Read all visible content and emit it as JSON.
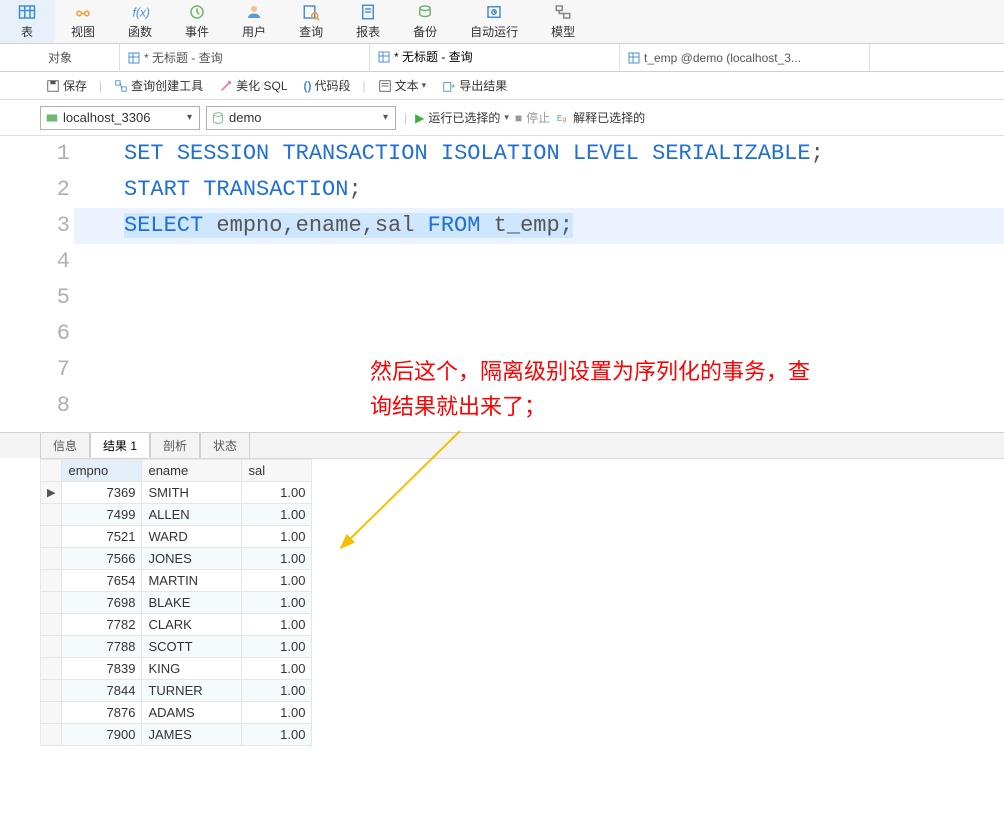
{
  "top_toolbar": {
    "table": "表",
    "view": "视图",
    "function": "函数",
    "event": "事件",
    "user": "用户",
    "query": "查询",
    "report": "报表",
    "backup": "备份",
    "autorun": "自动运行",
    "model": "模型"
  },
  "doc_tabs": {
    "object": "对象",
    "untitled1": "* 无标题 - 查询",
    "untitled2": "* 无标题 - 查询",
    "temp_tab": "t_emp @demo (localhost_3..."
  },
  "second_toolbar": {
    "save": "保存",
    "query_builder": "查询创建工具",
    "beautify": "美化 SQL",
    "snippet": "代码段",
    "text": "文本",
    "export": "导出结果"
  },
  "conn_bar": {
    "host": "localhost_3306",
    "db": "demo",
    "run_selected": "运行已选择的",
    "stop": "停止",
    "explain": "解释已选择的"
  },
  "sql": {
    "line1": {
      "a": "SET",
      "b": "SESSION",
      "c": "TRANSACTION",
      "d": "ISOLATION",
      "e": "LEVEL",
      "f": "SERIALIZABLE",
      "semi": ";"
    },
    "line2": {
      "a": "START",
      "b": "TRANSACTION",
      "semi": ";"
    },
    "line3": {
      "a": "SELECT",
      "cols": " empno,ename,sal ",
      "b": "FROM",
      "tbl": " t_emp",
      "semi": ";"
    }
  },
  "line_numbers": [
    "1",
    "2",
    "3",
    "4",
    "5",
    "6",
    "7",
    "8"
  ],
  "annotation": {
    "l1": "然后这个，隔离级别设置为序列化的事务，查",
    "l2": "询结果就出来了；"
  },
  "result_tabs": {
    "info": "信息",
    "result1": "结果 1",
    "profile": "剖析",
    "status": "状态"
  },
  "columns": {
    "empno": "empno",
    "ename": "ename",
    "sal": "sal"
  },
  "rows": [
    {
      "empno": "7369",
      "ename": "SMITH",
      "sal": "1.00"
    },
    {
      "empno": "7499",
      "ename": "ALLEN",
      "sal": "1.00"
    },
    {
      "empno": "7521",
      "ename": "WARD",
      "sal": "1.00"
    },
    {
      "empno": "7566",
      "ename": "JONES",
      "sal": "1.00"
    },
    {
      "empno": "7654",
      "ename": "MARTIN",
      "sal": "1.00"
    },
    {
      "empno": "7698",
      "ename": "BLAKE",
      "sal": "1.00"
    },
    {
      "empno": "7782",
      "ename": "CLARK",
      "sal": "1.00"
    },
    {
      "empno": "7788",
      "ename": "SCOTT",
      "sal": "1.00"
    },
    {
      "empno": "7839",
      "ename": "KING",
      "sal": "1.00"
    },
    {
      "empno": "7844",
      "ename": "TURNER",
      "sal": "1.00"
    },
    {
      "empno": "7876",
      "ename": "ADAMS",
      "sal": "1.00"
    },
    {
      "empno": "7900",
      "ename": "JAMES",
      "sal": "1.00"
    }
  ]
}
